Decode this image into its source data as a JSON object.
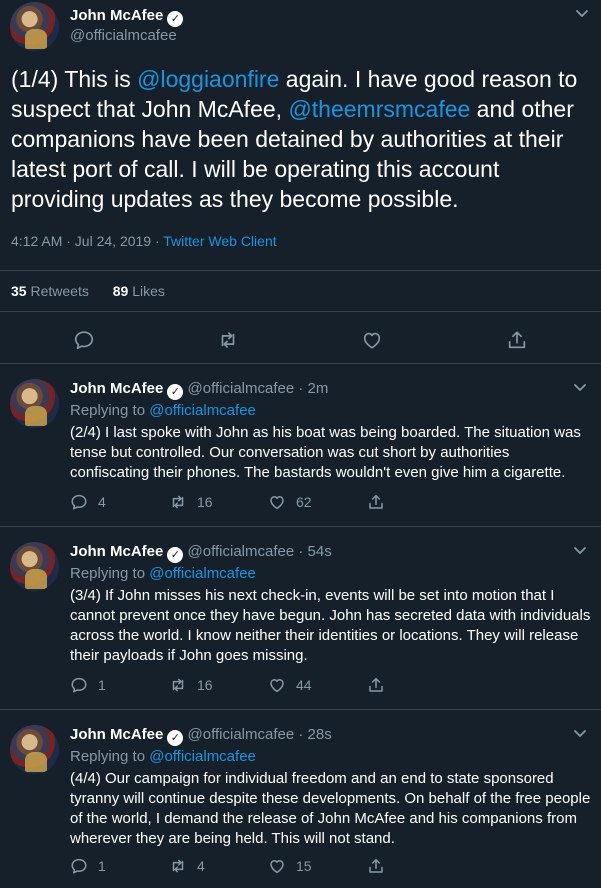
{
  "main_tweet": {
    "display_name": "John McAfee",
    "handle": "@officialmcafee",
    "text_parts": {
      "p1": "(1/4) This is ",
      "mention1": "@loggiaonfire",
      "p2": " again. I have good reason to suspect that John McAfee, ",
      "mention2": "@theemrsmcafee",
      "p3": " and other companions have been detained by authorities at their latest port of call. I will be operating this account providing updates as they become possible."
    },
    "timestamp": "4:12 AM · Jul 24, 2019 · ",
    "client": "Twitter Web Client",
    "retweets_count": "35",
    "retweets_label": "Retweets",
    "likes_count": "89",
    "likes_label": "Likes"
  },
  "replies": [
    {
      "display_name": "John McAfee",
      "handle": "@officialmcafee",
      "time": "2m",
      "replying_label": "Replying to ",
      "replying_to": "@officialmcafee",
      "text": "(2/4) I last spoke with John as his boat was being boarded. The situation was tense but controlled. Our conversation was cut short by authorities confiscating their phones. The bastards wouldn't even give him a cigarette.",
      "reply_count": "4",
      "retweet_count": "16",
      "like_count": "62"
    },
    {
      "display_name": "John McAfee",
      "handle": "@officialmcafee",
      "time": "54s",
      "replying_label": "Replying to ",
      "replying_to": "@officialmcafee",
      "text": "(3/4) If John misses his next check-in, events will be set into motion that I cannot prevent once they have begun.  John has secreted data with individuals across the world. I know neither their identities or locations. They will release their payloads if John goes missing.",
      "reply_count": "1",
      "retweet_count": "16",
      "like_count": "44"
    },
    {
      "display_name": "John McAfee",
      "handle": "@officialmcafee",
      "time": "28s",
      "replying_label": "Replying to ",
      "replying_to": "@officialmcafee",
      "text": "(4/4) Our campaign for individual freedom and an end to state sponsored tyranny will continue despite these developments. On behalf of the free people of the world, I demand the release of John McAfee and his companions from wherever they are being held. This will not stand.",
      "reply_count": "1",
      "retweet_count": "4",
      "like_count": "15"
    }
  ],
  "colors": {
    "background": "#15202b",
    "link": "#1b95e0",
    "muted": "#8899a6",
    "divider": "#38444d"
  },
  "icons": [
    "avatar",
    "verified-badge-icon",
    "chevron-down-icon",
    "reply-icon",
    "retweet-icon",
    "like-icon",
    "share-icon"
  ]
}
